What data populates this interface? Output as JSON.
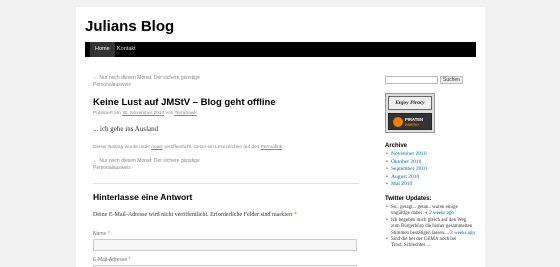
{
  "site": {
    "title": "Julians Blog"
  },
  "menu": {
    "items": [
      {
        "label": "Home"
      },
      {
        "label": "Kontakt"
      }
    ]
  },
  "nav": {
    "prev_arrow": "←",
    "prev_top": "Nur noch diesen Monat: Der sichere günstige Personalausweis",
    "prev_bottom": "Nur noch diesen Monat: Der sichere günstige Personalausweis"
  },
  "post": {
    "title": "Keine Lust auf JMStV – Blog geht offline",
    "meta_prefix": "Publiziert am",
    "meta_date": "30. November 2010",
    "meta_by": "von",
    "meta_author": "Terrahawk",
    "content": "... ich gehe ins Ausland",
    "footer_prefix": "Dieser Beitrag wurde unter",
    "footer_category": "news",
    "footer_middle": "veröffentlicht. Setze ein Lesezeichen auf den",
    "footer_permalink": "Permalink",
    "footer_end": "."
  },
  "reply": {
    "title": "Hinterlasse eine Antwort",
    "notes": "Deine E-Mail-Adresse wird nicht veröffentlicht. Erforderliche Felder sind markiert",
    "required_mark": "*",
    "name_label": "Name",
    "email_label": "E-Mail-Adresse"
  },
  "search": {
    "button_label": "Suchen"
  },
  "badge": {
    "top_text": "Enjoy Piracy",
    "line1": "PIRATEN",
    "line2": "PARTEI"
  },
  "archive": {
    "title": "Archive",
    "items": [
      {
        "label": "November 2010"
      },
      {
        "label": "Oktober 2010"
      },
      {
        "label": "September 2010"
      },
      {
        "label": "August 2010"
      },
      {
        "label": "Mai 2010"
      }
    ]
  },
  "twitter": {
    "title": "Twitter Updates:",
    "tweets": [
      {
        "text": "So.. geragt... getan.. waren einige ungültige dabei :-(",
        "time": "2 weeks ago"
      },
      {
        "text": "Ich begeben mich gleich auf den Weg zum Bürgerbüro die bisher gesammelten Stimmen bestätigen lassen....",
        "time": "2 weeks ago"
      },
      {
        "text": "Sind die bei der GEMA noch bei Trost..Schlechtes ...",
        "time": ""
      }
    ]
  },
  "colors": {
    "menu_bg": "#000000",
    "link": "#0066cc",
    "required": "#ff4b33",
    "pirate_orange": "#f08000"
  }
}
